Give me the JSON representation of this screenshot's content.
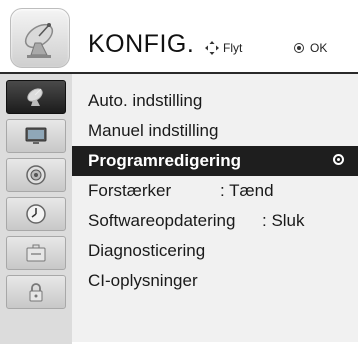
{
  "header": {
    "title": "KONFIG.",
    "icon": "satellite-dish-icon",
    "hint_move_label": "Flyt",
    "hint_move_icon": "four-way-arrow-icon",
    "hint_ok_label": "OK",
    "hint_ok_icon": "ok-circle-icon"
  },
  "sidebar": {
    "items": [
      {
        "icon": "satellite-dish-icon",
        "active": true
      },
      {
        "icon": "monitor-icon",
        "active": false
      },
      {
        "icon": "speaker-icon",
        "active": false
      },
      {
        "icon": "clock-icon",
        "active": false
      },
      {
        "icon": "toolbox-icon",
        "active": false
      },
      {
        "icon": "lock-icon",
        "active": false
      }
    ]
  },
  "menu": {
    "items": [
      {
        "label": "Auto. indstilling",
        "value": ""
      },
      {
        "label": "Manuel indstilling",
        "value": ""
      },
      {
        "label": "Programredigering",
        "value": "",
        "selected": true
      },
      {
        "label": "Forstærker",
        "value": ": Tænd"
      },
      {
        "label": "Softwareopdatering",
        "value": ": Sluk"
      },
      {
        "label": "Diagnosticering",
        "value": ""
      },
      {
        "label": "CI-oplysninger",
        "value": ""
      }
    ]
  },
  "colors": {
    "selected_bg": "#1e1e1e",
    "menu_bg": "#f1f1f1",
    "sidebar_bg": "#dcdcdc"
  }
}
